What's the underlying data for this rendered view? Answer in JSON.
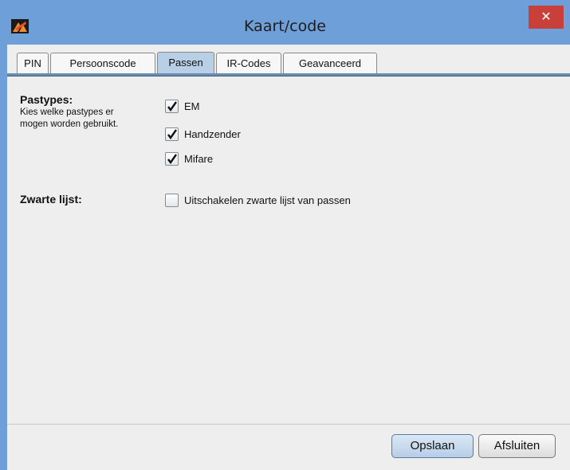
{
  "window": {
    "title": "Kaart/code",
    "close_glyph": "✕",
    "logo_icon": "app-logo-icon"
  },
  "tabs": [
    {
      "label": "PIN",
      "active": false
    },
    {
      "label": "Persoonscode",
      "active": false
    },
    {
      "label": "Passen",
      "active": true
    },
    {
      "label": "IR-Codes",
      "active": false
    },
    {
      "label": "Geavanceerd",
      "active": false
    }
  ],
  "pastypes": {
    "heading": "Pastypes:",
    "description_line1": "Kies welke pastypes er",
    "description_line2": "mogen worden gebruikt.",
    "options": [
      {
        "label": "EM",
        "checked": true
      },
      {
        "label": "Handzender",
        "checked": true
      },
      {
        "label": "Mifare",
        "checked": true
      }
    ]
  },
  "blacklist": {
    "heading": "Zwarte lijst:",
    "option": {
      "label": "Uitschakelen zwarte lijst van passen",
      "checked": false
    }
  },
  "buttons": {
    "save": "Opslaan",
    "close": "Afsluiten"
  },
  "colors": {
    "titlebar": "#6f9fd8",
    "close_button": "#c9403a",
    "active_tab": "#b9cfe6"
  }
}
